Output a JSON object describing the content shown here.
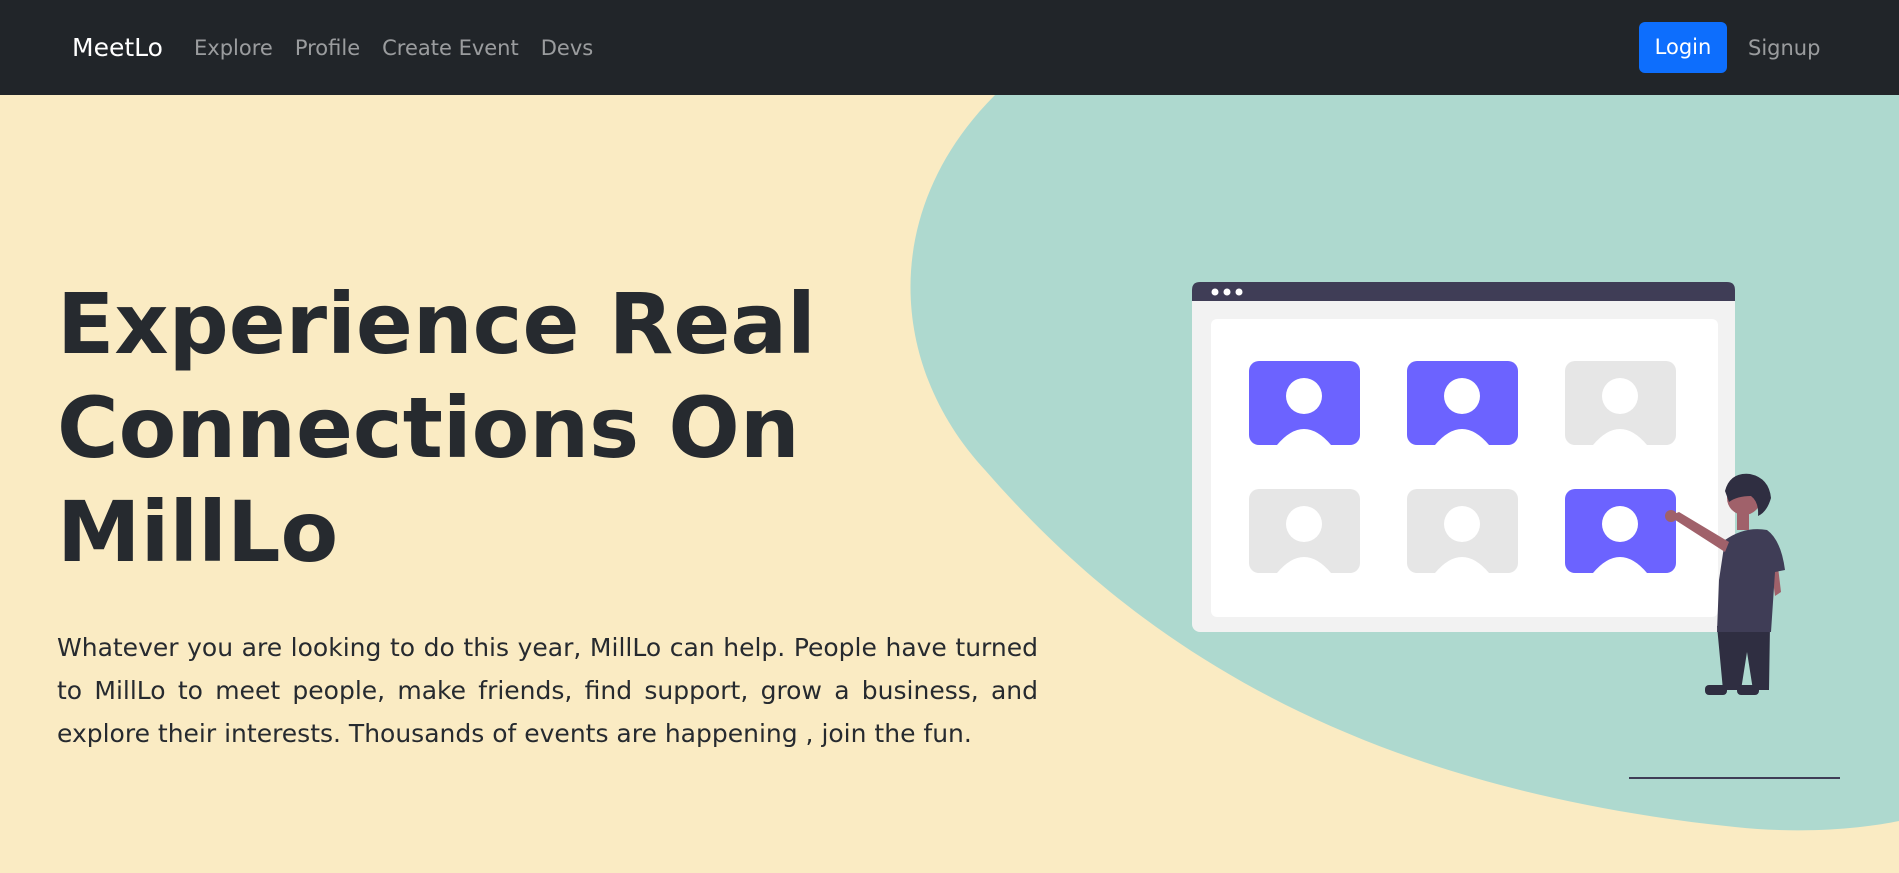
{
  "navbar": {
    "brand": "MeetLo",
    "links": [
      "Explore",
      "Profile",
      "Create Event",
      "Devs"
    ],
    "login_label": "Login",
    "signup_label": "Signup"
  },
  "hero": {
    "headline": "Experience Real Connections On MillLo",
    "intro": "Whatever you are looking to do this year, MillLo can help. People have turned to MillLo to meet people, make friends, find support, grow a business, and explore their interests. Thousands of events are happening , join the fun.",
    "illustration_icon": "video-conference-illustration"
  },
  "colors": {
    "navbar_bg": "#212529",
    "primary_button": "#0d6efd",
    "hero_bg": "#faebc3",
    "hero_blob": "#aed9cf",
    "accent_purple": "#6c63ff",
    "heading_text": "#262a2f"
  }
}
